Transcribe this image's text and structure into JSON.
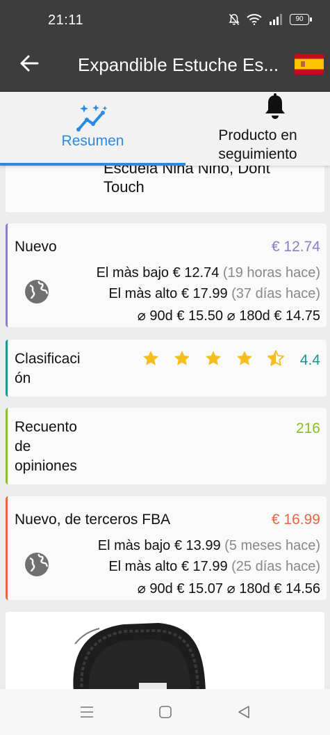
{
  "status": {
    "time": "21:11",
    "battery": "90"
  },
  "appbar": {
    "title": "Expandible Estuche Es..."
  },
  "tabs": [
    {
      "label": "Resumen"
    },
    {
      "label_line1": "Producto en",
      "label_line2": "seguimiento"
    }
  ],
  "product": {
    "title_fragment_1": "Escuela Nina Nino, Dont",
    "title_fragment_2": "Touch"
  },
  "nuevo": {
    "label": "Nuevo",
    "price": "€ 12.74",
    "lowest_label": "El màs bajo",
    "lowest_price": "€ 12.74",
    "lowest_when": "(19 horas hace)",
    "highest_label": "El màs alto",
    "highest_price": "€ 17.99",
    "highest_when": "(37 días hace)",
    "avg90_label": "⌀ 90d",
    "avg90": "€ 15.50",
    "avg180_label": "⌀ 180d",
    "avg180": "€ 14.75",
    "color": "#8a7fc4"
  },
  "rating": {
    "label_line1": "Clasificaci",
    "label_line2": "ón",
    "value": "4.4",
    "stars": 4.4,
    "color": "#14998a"
  },
  "reviews": {
    "label_line1": "Recuento",
    "label_line2": "de",
    "label_line3": "opiniones",
    "value": "216",
    "color": "#8bbf2a"
  },
  "fba": {
    "label": "Nuevo, de terceros FBA",
    "price": "€ 16.99",
    "lowest_label": "El màs bajo",
    "lowest_price": "€ 13.99",
    "lowest_when": "(5 meses hace)",
    "highest_label": "El màs alto",
    "highest_price": "€ 17.99",
    "highest_when": "(25 días hace)",
    "avg90_label": "⌀ 90d",
    "avg90": "€ 15.07",
    "avg180_label": "⌀ 180d",
    "avg180": "€ 14.56",
    "color": "#e8663d"
  },
  "colors": {
    "accent_blue": "#2b8ae3",
    "star": "#f5be1d",
    "appbar": "#3d3d3d"
  }
}
